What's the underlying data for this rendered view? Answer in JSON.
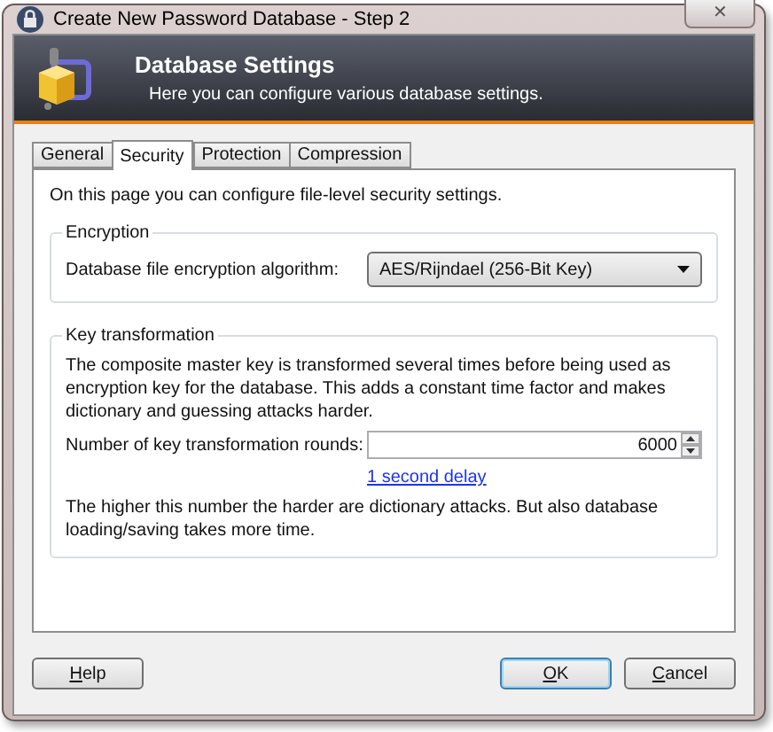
{
  "window": {
    "title": "Create New Password Database - Step 2",
    "close": "✕"
  },
  "banner": {
    "title": "Database Settings",
    "subtitle": "Here you can configure various database settings."
  },
  "tabs": [
    {
      "label": "General",
      "selected": false
    },
    {
      "label": "Security",
      "selected": true
    },
    {
      "label": "Protection",
      "selected": false
    },
    {
      "label": "Compression",
      "selected": false
    }
  ],
  "intro": "On this page you can configure file-level security settings.",
  "encryption": {
    "legend": "Encryption",
    "label": "Database file encryption algorithm:",
    "value": "AES/Rijndael (256-Bit Key)"
  },
  "key_transformation": {
    "legend": "Key transformation",
    "description": "The composite master key is transformed several times before being used as encryption key for the database. This adds a constant time factor and makes dictionary and guessing attacks harder.",
    "label": "Number of key transformation rounds:",
    "value": "6000",
    "link": "1 second delay",
    "note": "The higher this number the harder are dictionary attacks. But also database loading/saving takes more time."
  },
  "buttons": [
    {
      "label": "Help",
      "kind": "help",
      "default": false
    },
    {
      "label": "OK",
      "kind": "ok",
      "default": true
    },
    {
      "label": "Cancel",
      "kind": "cancel",
      "default": false
    }
  ]
}
